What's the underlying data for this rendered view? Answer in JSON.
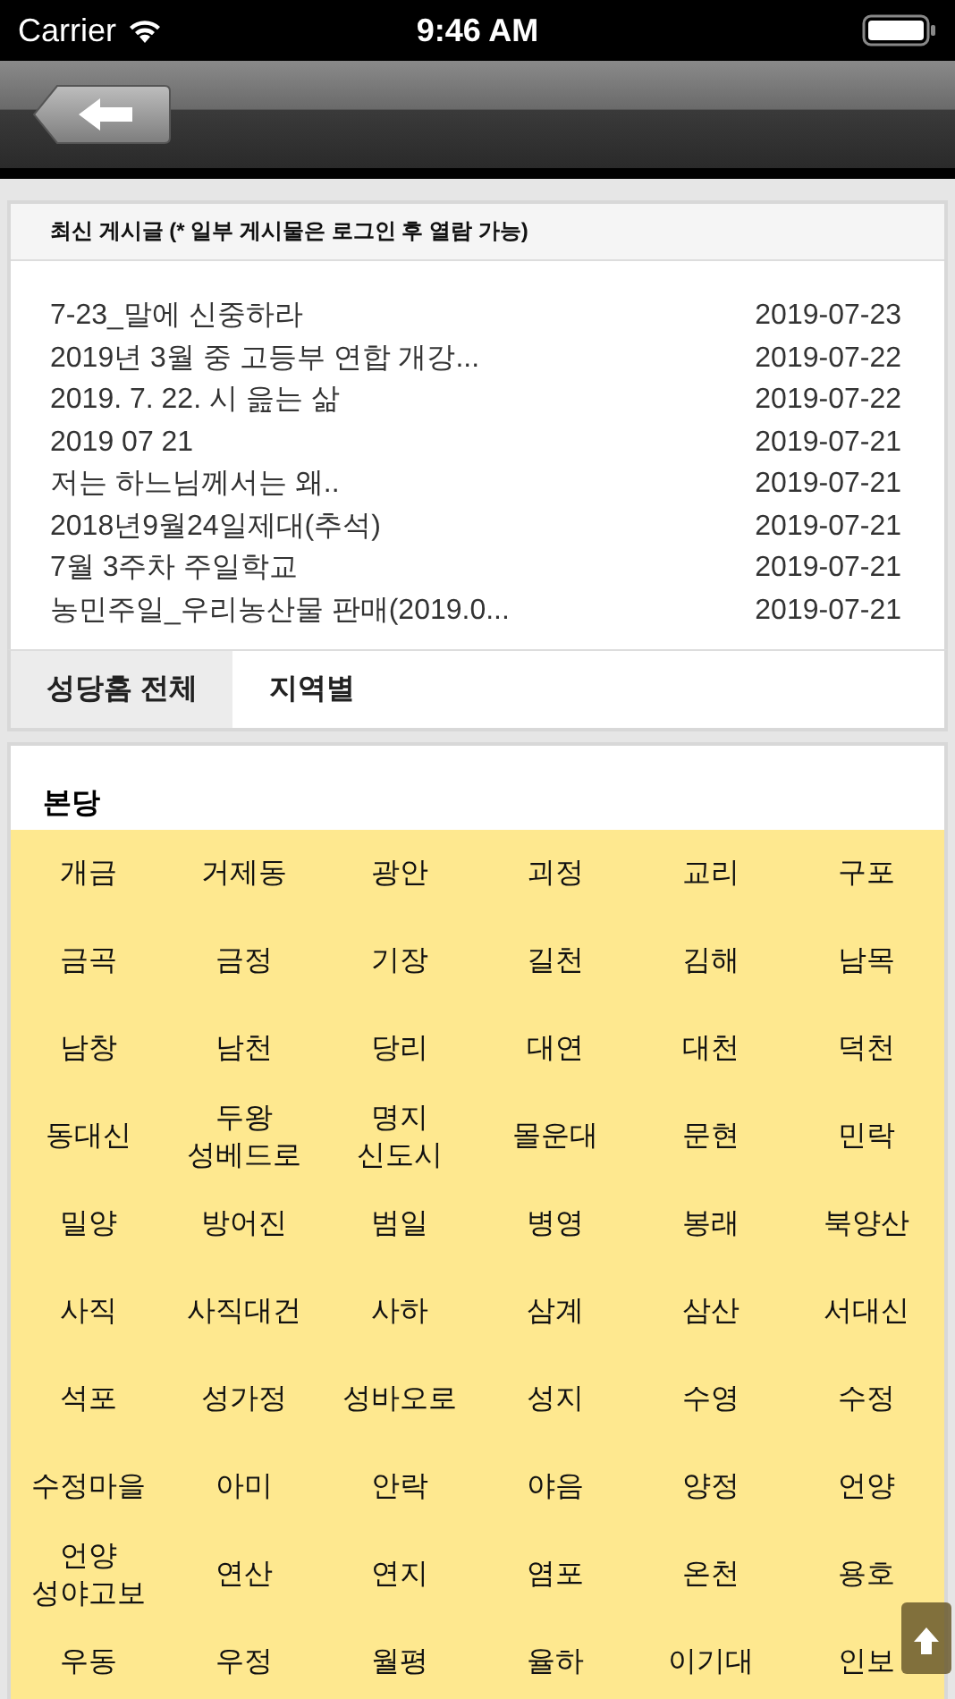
{
  "status_bar": {
    "carrier": "Carrier",
    "time": "9:46 AM"
  },
  "recent_posts": {
    "title": "최신 게시글 (* 일부 게시물은 로그인 후 열람 가능)",
    "posts": [
      {
        "title": "7-23_말에 신중하라",
        "date": "2019-07-23"
      },
      {
        "title": "2019년 3월 중 고등부 연합 개강...",
        "date": "2019-07-22"
      },
      {
        "title": "2019. 7. 22. 시 읊는 삶",
        "date": "2019-07-22"
      },
      {
        "title": "2019 07 21",
        "date": "2019-07-21"
      },
      {
        "title": "저는 하느님께서는 왜..",
        "date": "2019-07-21"
      },
      {
        "title": "2018년9월24일제대(추석)",
        "date": "2019-07-21"
      },
      {
        "title": "7월 3주차 주일학교",
        "date": "2019-07-21"
      },
      {
        "title": "농민주일_우리농산물 판매(2019.0...",
        "date": "2019-07-21"
      }
    ]
  },
  "tabs": [
    {
      "label": "성당홈 전체",
      "selected": true
    },
    {
      "label": "지역별",
      "selected": false
    }
  ],
  "region": {
    "title": "본당",
    "parishes": [
      "개금",
      "거제동",
      "광안",
      "괴정",
      "교리",
      "구포",
      "금곡",
      "금정",
      "기장",
      "길천",
      "김해",
      "남목",
      "남창",
      "남천",
      "당리",
      "대연",
      "대천",
      "덕천",
      "동대신",
      "두왕\n성베드로",
      "명지\n신도시",
      "몰운대",
      "문현",
      "민락",
      "밀양",
      "방어진",
      "범일",
      "병영",
      "봉래",
      "북양산",
      "사직",
      "사직대건",
      "사하",
      "삼계",
      "삼산",
      "서대신",
      "석포",
      "성가정",
      "성바오로",
      "성지",
      "수영",
      "수정",
      "수정마을",
      "아미",
      "안락",
      "야음",
      "양정",
      "언양",
      "언양\n성야고보",
      "연산",
      "연지",
      "염포",
      "온천",
      "용호",
      "우동",
      "우정",
      "월평",
      "율하",
      "이기대",
      "인보"
    ]
  }
}
